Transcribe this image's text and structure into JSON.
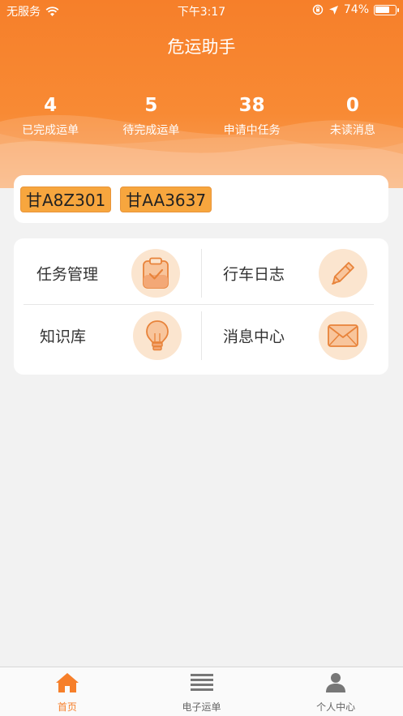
{
  "status_bar": {
    "carrier": "无服务",
    "time": "下午3:17",
    "battery_percent": "74%",
    "battery_level": 0.74
  },
  "header": {
    "title": "危运助手"
  },
  "stats": [
    {
      "value": "4",
      "label": "已完成运单"
    },
    {
      "value": "5",
      "label": "待完成运单"
    },
    {
      "value": "38",
      "label": "申请中任务"
    },
    {
      "value": "0",
      "label": "未读消息"
    }
  ],
  "plates": [
    "甘A8Z301",
    "甘AA3637"
  ],
  "menu": [
    {
      "label": "任务管理",
      "icon": "clipboard-icon"
    },
    {
      "label": "行车日志",
      "icon": "pencil-icon"
    },
    {
      "label": "知识库",
      "icon": "lightbulb-icon"
    },
    {
      "label": "消息中心",
      "icon": "envelope-icon"
    }
  ],
  "tabs": [
    {
      "label": "首页",
      "icon": "home-icon",
      "active": true
    },
    {
      "label": "电子运单",
      "icon": "list-icon",
      "active": false
    },
    {
      "label": "个人中心",
      "icon": "person-icon",
      "active": false
    }
  ],
  "colors": {
    "accent": "#f67f2a",
    "plate_bg": "#f7a63e",
    "icon_circle": "#fbe5cf"
  }
}
